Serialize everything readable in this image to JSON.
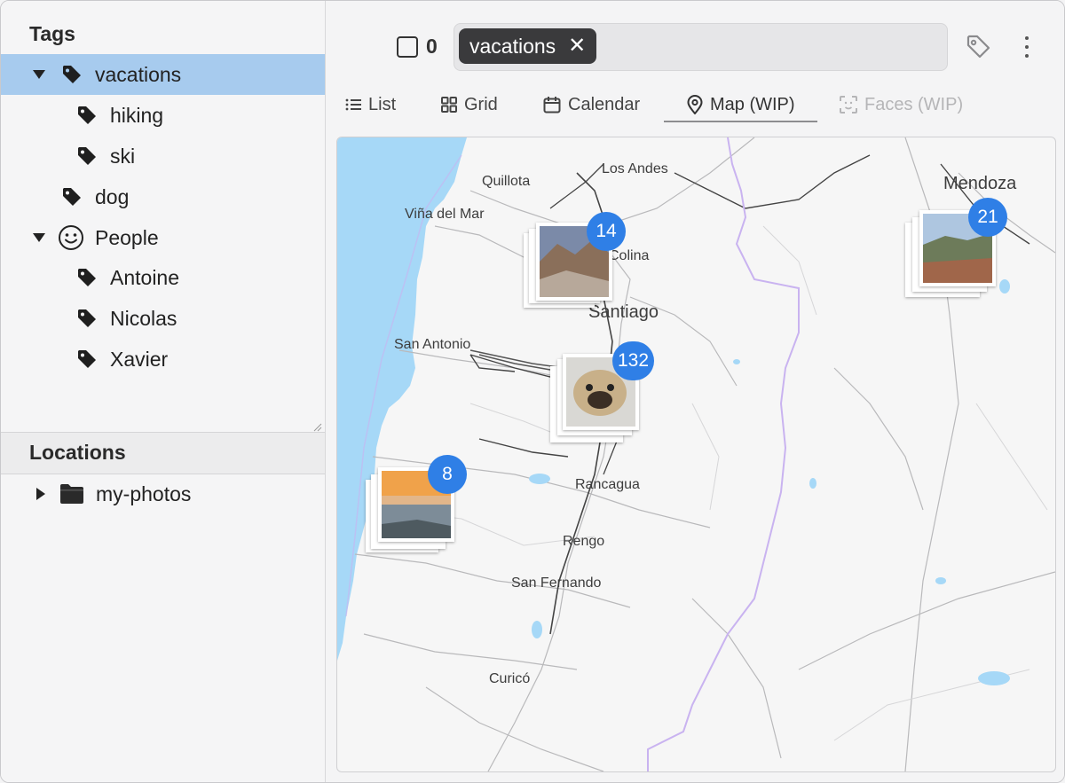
{
  "sidebar": {
    "tags_title": "Tags",
    "tags": [
      {
        "label": "vacations"
      },
      {
        "label": "hiking"
      },
      {
        "label": "ski"
      },
      {
        "label": "dog"
      },
      {
        "label": "People"
      },
      {
        "label": "Antoine"
      },
      {
        "label": "Nicolas"
      },
      {
        "label": "Xavier"
      }
    ],
    "locations_title": "Locations",
    "locations": [
      {
        "label": "my-photos"
      }
    ]
  },
  "toolbar": {
    "selected_count": "0",
    "search_chip": "vacations",
    "chip_close": "✕",
    "tags_icon": "tag-outline-icon",
    "more_icon": "more-vertical-icon"
  },
  "tabs": [
    {
      "label": "List",
      "icon": "list-icon"
    },
    {
      "label": "Grid",
      "icon": "grid-icon"
    },
    {
      "label": "Calendar",
      "icon": "calendar-icon"
    },
    {
      "label": "Map (WIP)",
      "icon": "map-pin-icon",
      "active": true
    },
    {
      "label": "Faces (WIP)",
      "icon": "face-scan-icon",
      "disabled": true
    }
  ],
  "map": {
    "cities": [
      "Los Andes",
      "Quillota",
      "Mendoza",
      "Viña del Mar",
      "Colina",
      "Santiago",
      "San Antonio",
      "Rancagua",
      "Rengo",
      "San Fernando",
      "Curicó"
    ],
    "clusters": [
      {
        "count": "14"
      },
      {
        "count": "21"
      },
      {
        "count": "132"
      },
      {
        "count": "8"
      }
    ],
    "colors": {
      "ocean": "#a6d8f7",
      "border": "#c9b3f0",
      "cluster_badge": "#2f7fe6",
      "selected_row": "#a7cbee"
    }
  }
}
